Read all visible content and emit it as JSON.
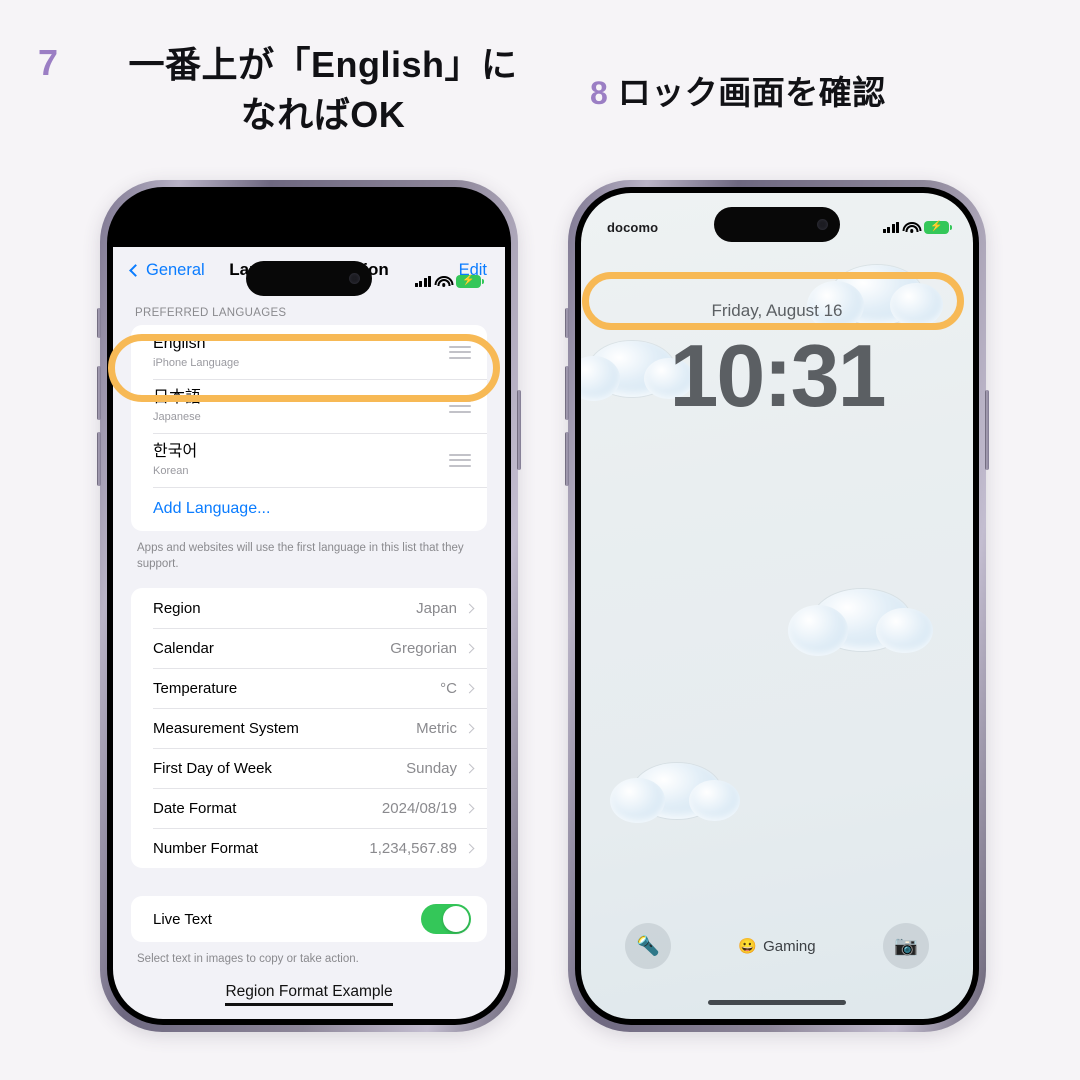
{
  "page": {
    "background_color": "#f6f4f7",
    "accent_purple": "#9b7ec4",
    "highlight_color": "#f7b955"
  },
  "headings": [
    {
      "number": "7",
      "text_line1": "一番上が「English」に",
      "text_line2": "なればOK"
    },
    {
      "number": "8",
      "text_line1": "ロック画面を確認",
      "text_line2": ""
    }
  ],
  "left_phone": {
    "status_bar": {
      "carrier": "",
      "signal": "signal-icon",
      "wifi": "wifi-icon",
      "battery": "battery-charging-icon",
      "battery_bolt": "⚡"
    },
    "navbar": {
      "back_label": "General",
      "title": "Language & Region",
      "edit_label": "Edit"
    },
    "preferred_languages_header": "PREFERRED LANGUAGES",
    "languages": [
      {
        "name": "English",
        "subtitle": "iPhone Language",
        "highlighted": true
      },
      {
        "name": "日本語",
        "subtitle": "Japanese",
        "highlighted": false
      },
      {
        "name": "한국어",
        "subtitle": "Korean",
        "highlighted": false
      }
    ],
    "add_language_label": "Add Language...",
    "footnote": "Apps and websites will use the first language in this list that they support.",
    "settings": [
      {
        "label": "Region",
        "value": "Japan"
      },
      {
        "label": "Calendar",
        "value": "Gregorian"
      },
      {
        "label": "Temperature",
        "value": "°C"
      },
      {
        "label": "Measurement System",
        "value": "Metric"
      },
      {
        "label": "First Day of Week",
        "value": "Sunday"
      },
      {
        "label": "Date Format",
        "value": "2024/08/19"
      },
      {
        "label": "Number Format",
        "value": "1,234,567.89"
      }
    ],
    "live_text": {
      "label": "Live Text",
      "enabled": "on",
      "footnote": "Select text in images to copy or take action."
    },
    "bottom_header": "Region Format Example"
  },
  "right_phone": {
    "status_bar": {
      "carrier": "docomo",
      "signal": "signal-icon",
      "wifi": "wifi-icon",
      "battery": "battery-charging-icon",
      "battery_bolt": "⚡"
    },
    "lock": {
      "date": "Friday, August 16",
      "time": "10:31",
      "focus_label": "Gaming",
      "focus_emoji": "😀",
      "flashlight_icon": "🔦",
      "camera_icon": "📷"
    }
  }
}
